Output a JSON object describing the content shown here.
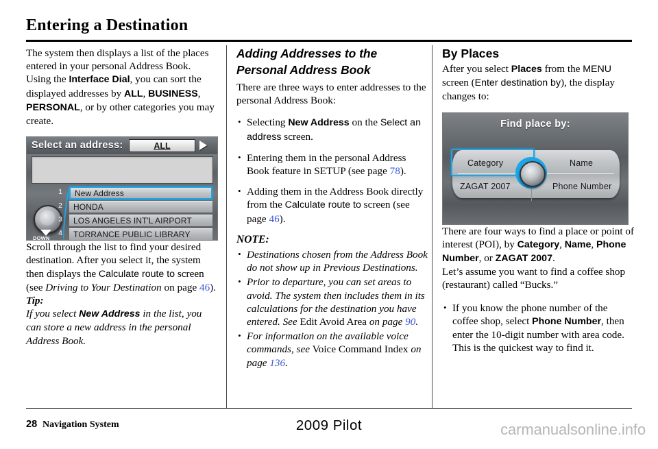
{
  "page_title": "Entering a Destination",
  "col1": {
    "para1": {
      "t1": "The system then displays a list of the places entered in your personal Address Book. Using the ",
      "b1": "Interface Dial",
      "t2": ", you can sort the displayed addresses by ",
      "b2": "ALL",
      "t3": ", ",
      "b3": "BUSINESS",
      "t4": ", ",
      "b4": "PERSONAL",
      "t5": ", or by other categories you may create."
    },
    "nav_screen": {
      "header_label": "Select an address:",
      "filter_button": "ALL",
      "arrow_icon": "right-triangle-icon",
      "dial_down_label": "DOWN",
      "rows": [
        {
          "num": "1",
          "label": "New Address",
          "selected": true
        },
        {
          "num": "2",
          "label": "HONDA",
          "selected": false
        },
        {
          "num": "3",
          "label": "LOS ANGELES INT'L AIRPORT",
          "selected": false
        },
        {
          "num": "4",
          "label": "TORRANCE PUBLIC LIBRARY",
          "selected": false
        }
      ]
    },
    "para2": {
      "t1": "Scroll through the list to find your desired destination. After you select it, the system then displays the ",
      "b1": "Calculate route to",
      "t2": " screen (see ",
      "i1": "Driving to Your Destination",
      "t3": " on page ",
      "pg": "46",
      "t4": ")."
    },
    "tip_label": "Tip:",
    "tip": {
      "t1": "If you select ",
      "b1": "New Address",
      "t2": " in the list, you can store a new address in the personal Address Book."
    }
  },
  "col2": {
    "heading_line1": "Adding Addresses to the",
    "heading_line2": "Personal Address Book",
    "intro": "There are three ways to enter addresses to the personal Address Book:",
    "bullets": [
      {
        "t1": "Selecting ",
        "b1": "New Address",
        "t2": " on the ",
        "ui1": "Select an address",
        "t3": " screen."
      },
      {
        "t1": "Entering them in the personal Address Book feature in SETUP (see page ",
        "pg": "78",
        "t2": ")."
      },
      {
        "t1": "Adding them in the Address Book directly from the ",
        "ui1": "Calculate route to",
        "t2": " screen (see page ",
        "pg": "46",
        "t3": ")."
      }
    ],
    "note_label": "NOTE:",
    "notes": [
      {
        "t1": "Destinations chosen from the Address Book do not show up in Previous Destinations."
      },
      {
        "t1": "Prior to departure, you can set areas to avoid. The system then includes them in its calculations for the destination you have entered. See ",
        "r1": "Edit Avoid Area",
        "t2": " on page ",
        "pg": "90",
        "t3": "."
      },
      {
        "t1": "For information on the available voice commands, see ",
        "r1": "Voice Command Index",
        "t2": " on page ",
        "pg": "136",
        "t3": "."
      }
    ]
  },
  "col3": {
    "heading": "By Places",
    "para1": {
      "t1": "After you select ",
      "b1": "Places",
      "t2": " from the ",
      "ui1": "MENU",
      "t3": " screen (",
      "ui2": "Enter destination by",
      "t4": "), the display changes to:"
    },
    "nav_screen": {
      "title": "Find place by:",
      "cells": [
        {
          "label": "Category",
          "selected": true
        },
        {
          "label": "Name",
          "selected": false
        },
        {
          "label": "ZAGAT 2007",
          "selected": false
        },
        {
          "label": "Phone Number",
          "selected": false
        }
      ],
      "knob_icon": "interface-dial-knob-icon"
    },
    "para2": {
      "t1": "There are four ways to find a place or point of interest (POI), by ",
      "b1": "Category",
      "t2": ", ",
      "b2": "Name",
      "t3": ", ",
      "b3": "Phone Number",
      "t4": ", or ",
      "b4": "ZAGAT 2007",
      "t5": "."
    },
    "para3": "Let’s assume you want to find a coffee shop (restaurant) called “Bucks.”",
    "bullets": [
      {
        "t1": "If you know the phone number of the coffee shop, select ",
        "b1": "Phone Number",
        "t2": ", then enter the 10-digit number with area code. This is the quickest way to find it."
      }
    ]
  },
  "footer": {
    "page_number": "28",
    "section": "Navigation System",
    "model": "2009  Pilot",
    "watermark": "carmanualsonline.info"
  },
  "colors": {
    "page_ref": "#3a57d8",
    "nav_highlight": "#1ca6e8",
    "watermark": "#b6b6b6"
  }
}
